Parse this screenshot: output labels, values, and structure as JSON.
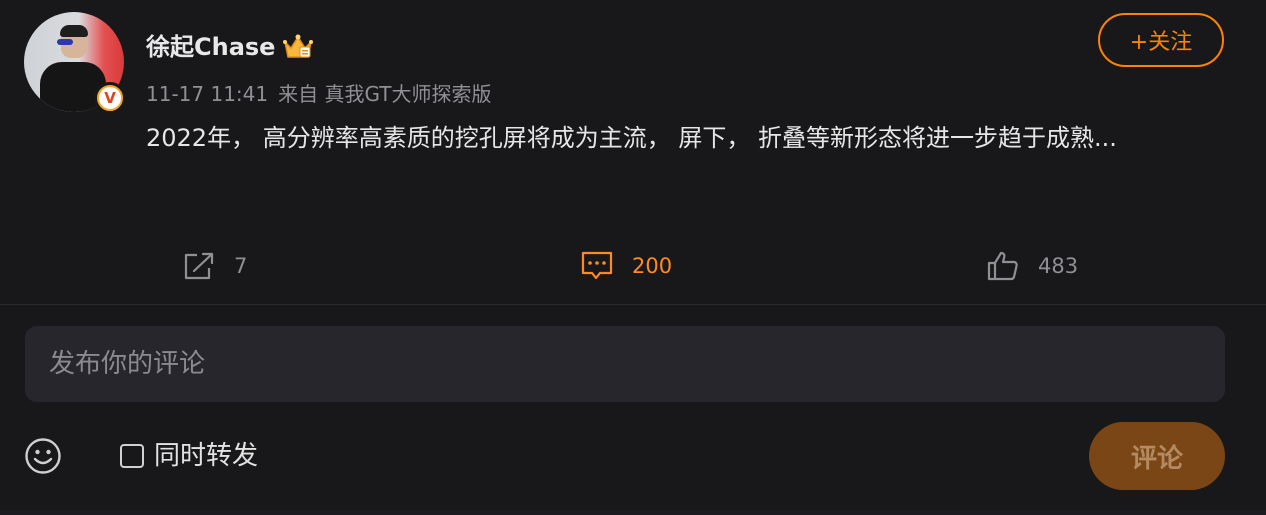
{
  "post": {
    "author": "徐起Chase",
    "date": "11-17 11:41",
    "source": "来自 真我GT大师探索版",
    "content": "2022年， 高分辨率高素质的挖孔屏将成为主流， 屏下， 折叠等新形态将进一步趋于成熟...",
    "follow_label": "+关注"
  },
  "actions": {
    "share_count": "7",
    "comment_count": "200",
    "like_count": "483"
  },
  "comment_form": {
    "placeholder": "发布你的评论",
    "repost_label": "同时转发",
    "submit_label": "评论"
  },
  "colors": {
    "accent": "#ff8200",
    "background": "#18181b",
    "input_bg": "#26262c"
  },
  "icons": {
    "share": "share-icon",
    "comment": "comment-icon",
    "like": "thumbs-up-icon",
    "emoji": "emoji-icon",
    "verified": "verified-v-badge-icon",
    "crown": "crown-badge-icon"
  }
}
